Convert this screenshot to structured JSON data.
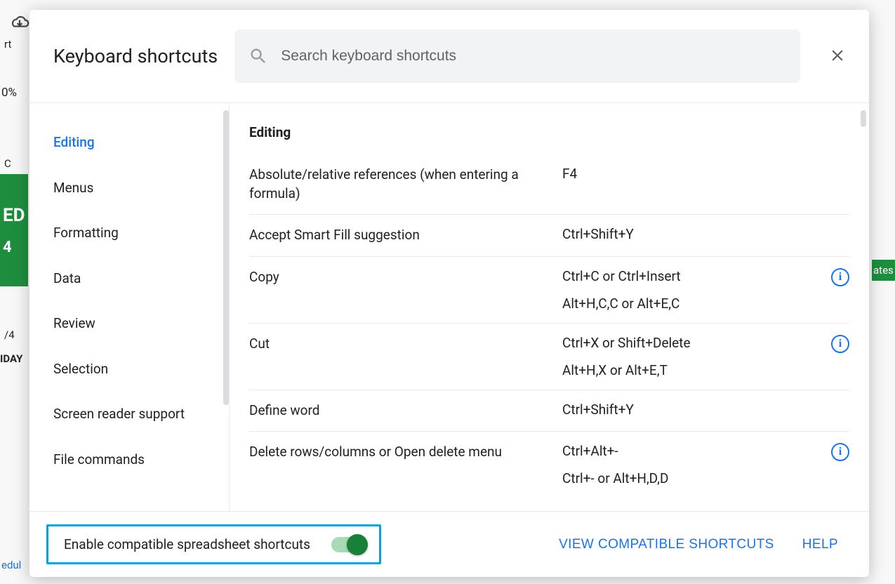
{
  "bg": {
    "toolbar_rt": "rt",
    "zoom": "0%",
    "green1": "ED",
    "green2": "4",
    "cell_c": "C",
    "numtext": "/4",
    "daytext": "IDAY",
    "ates": "ates",
    "edul": "edul"
  },
  "dialog": {
    "title": "Keyboard shortcuts",
    "search_placeholder": "Search keyboard shortcuts"
  },
  "sidebar": {
    "items": [
      {
        "label": "Editing",
        "active": true
      },
      {
        "label": "Menus",
        "active": false
      },
      {
        "label": "Formatting",
        "active": false
      },
      {
        "label": "Data",
        "active": false
      },
      {
        "label": "Review",
        "active": false
      },
      {
        "label": "Selection",
        "active": false
      },
      {
        "label": "Screen reader support",
        "active": false
      },
      {
        "label": "File commands",
        "active": false
      }
    ]
  },
  "section": {
    "title": "Editing",
    "rows": [
      {
        "label": "Absolute/relative references (when entering a formula)",
        "keys": [
          "F4"
        ],
        "info": false
      },
      {
        "label": "Accept Smart Fill suggestion",
        "keys": [
          "Ctrl+Shift+Y"
        ],
        "info": false
      },
      {
        "label": "Copy",
        "keys": [
          "Ctrl+C or Ctrl+Insert",
          "Alt+H,C,C or Alt+E,C"
        ],
        "info": true
      },
      {
        "label": "Cut",
        "keys": [
          "Ctrl+X or Shift+Delete",
          "Alt+H,X or Alt+E,T"
        ],
        "info": true
      },
      {
        "label": "Define word",
        "keys": [
          "Ctrl+Shift+Y"
        ],
        "info": false
      },
      {
        "label": "Delete rows/columns or Open delete menu",
        "keys": [
          "Ctrl+Alt+-",
          "Ctrl+- or Alt+H,D,D"
        ],
        "info": true
      }
    ]
  },
  "footer": {
    "compat_label": "Enable compatible spreadsheet shortcuts",
    "view_compat": "VIEW COMPATIBLE SHORTCUTS",
    "help": "HELP"
  }
}
